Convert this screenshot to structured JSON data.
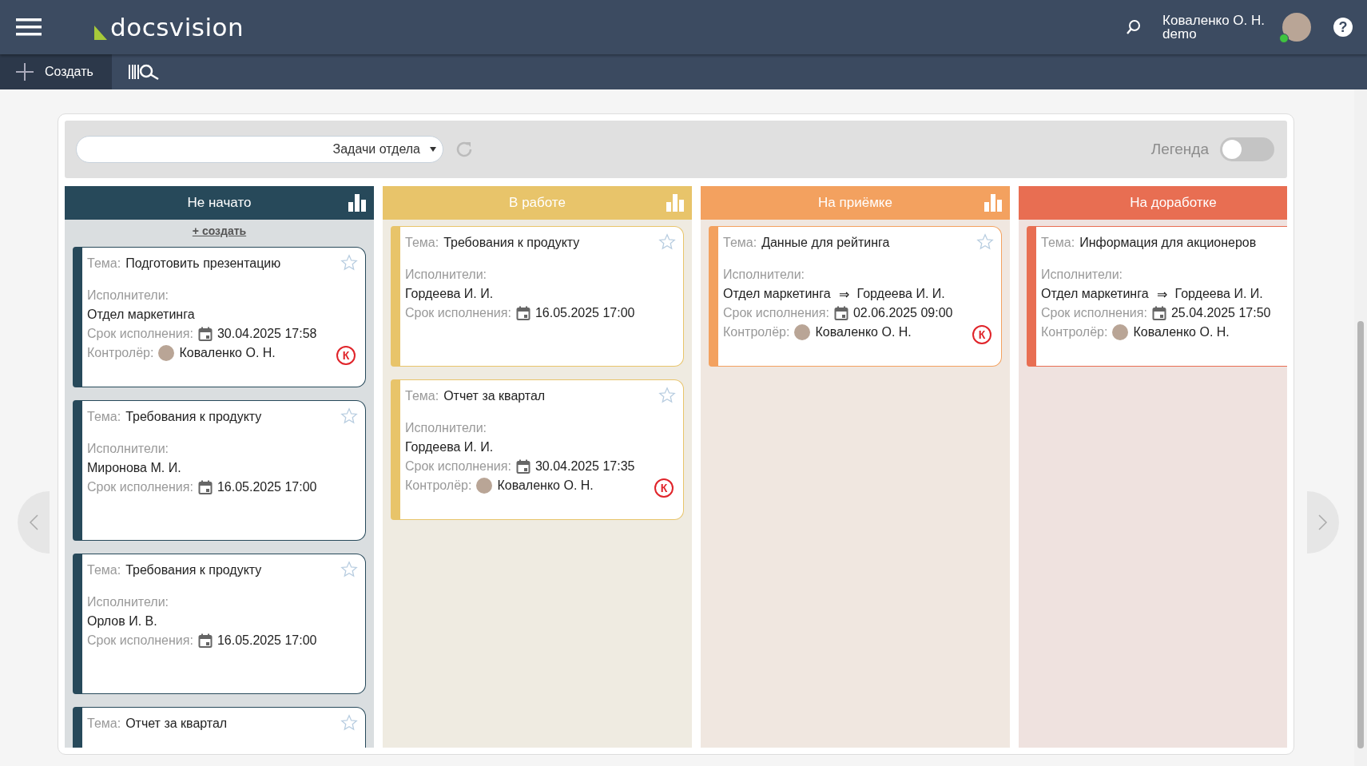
{
  "header": {
    "logo": "docsvision",
    "user_name": "Коваленко О. Н.",
    "user_login": "demo",
    "online": true,
    "help": "?"
  },
  "toolbar": {
    "create_button": "Создать"
  },
  "filter": {
    "view_value": "Задачи отдела",
    "legend_label": "Легенда",
    "legend_on": false
  },
  "columns": [
    {
      "title": "Не начато",
      "color": "#27495a",
      "stats": true,
      "create_link": "+ создать",
      "cards": [
        {
          "topic_label": "Тема:",
          "topic": "Подготовить презентацию",
          "starred": false,
          "performers_label": "Исполнители:",
          "performers": "Отдел маркетинга",
          "deadline_label": "Срок исполнения:",
          "deadline": "30.04.2025 17:58",
          "controller_label": "Контролёр:",
          "controller": "Коваленко О. Н.",
          "mark": "К"
        },
        {
          "topic_label": "Тема:",
          "topic": "Требования к продукту",
          "starred": false,
          "performers_label": "Исполнители:",
          "performers": "Миронова М. И.",
          "deadline_label": "Срок исполнения:",
          "deadline": "16.05.2025 17:00"
        },
        {
          "topic_label": "Тема:",
          "topic": "Требования к продукту",
          "starred": false,
          "performers_label": "Исполнители:",
          "performers": "Орлов И. В.",
          "deadline_label": "Срок исполнения:",
          "deadline": "16.05.2025 17:00"
        },
        {
          "topic_label": "Тема:",
          "topic": "Отчет за квартал",
          "starred": false
        }
      ]
    },
    {
      "title": "В работе",
      "color": "#e8c46a",
      "stats": true,
      "cards": [
        {
          "topic_label": "Тема:",
          "topic": "Требования к продукту",
          "starred": false,
          "performers_label": "Исполнители:",
          "performers": "Гордеева И. И.",
          "deadline_label": "Срок исполнения:",
          "deadline": "16.05.2025 17:00"
        },
        {
          "topic_label": "Тема:",
          "topic": "Отчет за квартал",
          "starred": false,
          "performers_label": "Исполнители:",
          "performers": "Гордеева И. И.",
          "deadline_label": "Срок исполнения:",
          "deadline": "30.04.2025 17:35",
          "controller_label": "Контролёр:",
          "controller": "Коваленко О. Н.",
          "mark": "К"
        }
      ]
    },
    {
      "title": "На приёмке",
      "color": "#f3a15f",
      "stats": true,
      "cards": [
        {
          "topic_label": "Тема:",
          "topic": "Данные для рейтинга",
          "starred": false,
          "performers_label": "Исполнители:",
          "performers": "Отдел маркетинга",
          "arrow": "⇒",
          "delegate": "Гордеева И. И.",
          "deadline_label": "Срок исполнения:",
          "deadline": "02.06.2025 09:00",
          "controller_label": "Контролёр:",
          "controller": "Коваленко О. Н.",
          "mark": "К"
        }
      ]
    },
    {
      "title": "На доработке",
      "color": "#e86e52",
      "cards": [
        {
          "topic_label": "Тема:",
          "topic": "Информация для акционеров",
          "performers_label": "Исполнители:",
          "performers": "Отдел маркетинга",
          "arrow": "⇒",
          "delegate": "Гордеева И. И.",
          "deadline_label": "Срок исполнения:",
          "deadline": "25.04.2025 17:50",
          "controller_label": "Контролёр:",
          "controller": "Коваленко О. Н."
        }
      ]
    }
  ]
}
